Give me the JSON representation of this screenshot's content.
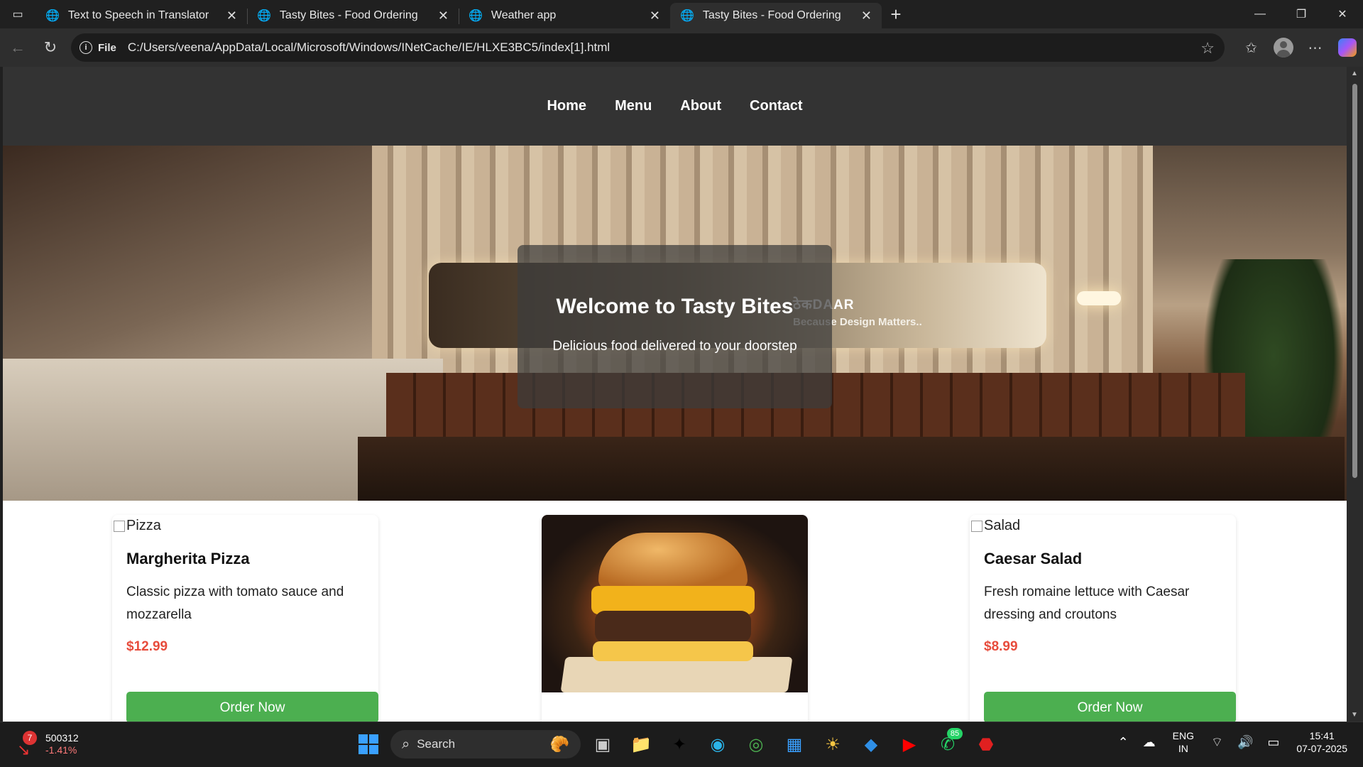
{
  "browser": {
    "tabs": [
      {
        "title": "Text to Speech in Translator",
        "active": false
      },
      {
        "title": "Tasty Bites - Food Ordering",
        "active": false
      },
      {
        "title": "Weather app",
        "active": false
      },
      {
        "title": "Tasty Bites - Food Ordering",
        "active": true
      }
    ],
    "url_scheme": "File",
    "url": "C:/Users/veena/AppData/Local/Microsoft/Windows/INetCache/IE/HLXE3BC5/index[1].html"
  },
  "site": {
    "nav": [
      "Home",
      "Menu",
      "About",
      "Contact"
    ],
    "hero": {
      "title": "Welcome to Tasty Bites",
      "subtitle": "Delicious food delivered to your doorstep",
      "image_brand": "ठेकDAAR",
      "image_brand_tagline": "Because Design Matters.."
    },
    "cards": [
      {
        "img_alt": "Pizza",
        "name": "Margherita Pizza",
        "desc": "Classic pizza with tomato sauce and mozzarella",
        "price": "$12.99",
        "button": "Order Now"
      },
      {
        "img_alt": "Burger",
        "name": "",
        "desc": "",
        "price": "",
        "button": ""
      },
      {
        "img_alt": "Salad",
        "name": "Caesar Salad",
        "desc": "Fresh romaine lettuce with Caesar dressing and croutons",
        "price": "$8.99",
        "button": "Order Now"
      }
    ]
  },
  "taskbar": {
    "stock_badge": "7",
    "stock_value": "500312",
    "stock_change": "-1.41%",
    "search_label": "Search",
    "whatsapp_badge": "85",
    "lang_top": "ENG",
    "lang_bottom": "IN",
    "time": "15:41",
    "date": "07-07-2025"
  },
  "colors": {
    "accent_price": "#e74c3c",
    "button_green": "#4caf50",
    "nav_bg": "#333333"
  }
}
